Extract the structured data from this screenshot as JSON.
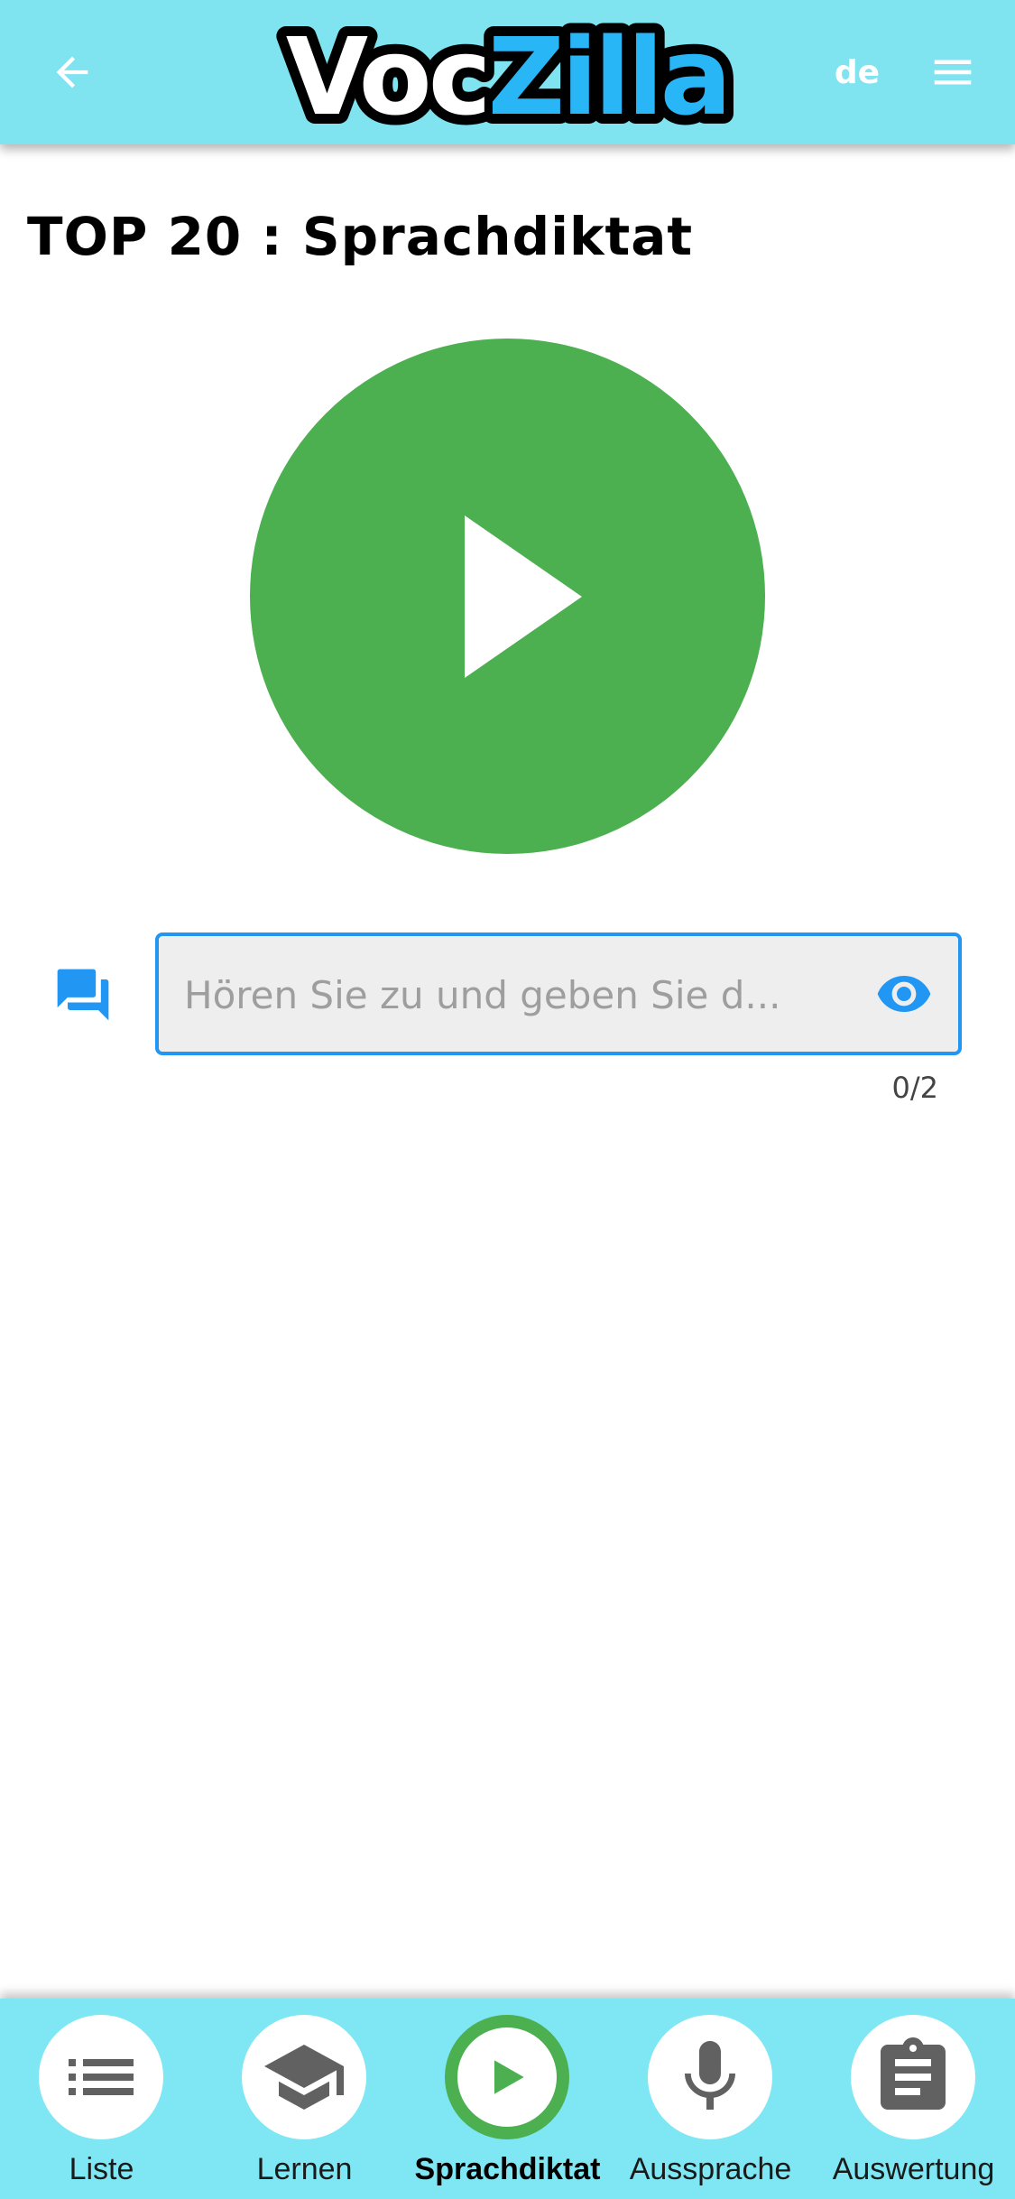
{
  "app": {
    "logo_text_part1": "Voc",
    "logo_text_part2": "Zilla"
  },
  "header": {
    "back_icon": "arrow-left-icon",
    "language": "de",
    "menu_icon": "hamburger-menu-icon"
  },
  "page": {
    "title": "TOP 20 : Sprachdiktat"
  },
  "player": {
    "icon": "play-icon"
  },
  "answer": {
    "placeholder": "Hören Sie zu und geben Sie d...",
    "value": "",
    "counter": "0/2",
    "left_icon": "chat-bubbles-icon",
    "reveal_icon": "eye-icon"
  },
  "nav": {
    "items": [
      {
        "label": "Liste",
        "icon": "list-icon",
        "active": false
      },
      {
        "label": "Lernen",
        "icon": "graduation-cap-icon",
        "active": false
      },
      {
        "label": "Sprachdiktat",
        "icon": "play-icon",
        "active": true
      },
      {
        "label": "Aussprache",
        "icon": "microphone-icon",
        "active": false
      },
      {
        "label": "Auswertung",
        "icon": "clipboard-icon",
        "active": false
      }
    ]
  },
  "colors": {
    "header_bg": "#7fe3f0",
    "nav_bg": "#7fe7f3",
    "play_green": "#4caf50",
    "accent_blue": "#2196f3",
    "logo_blue": "#29b6f6"
  }
}
